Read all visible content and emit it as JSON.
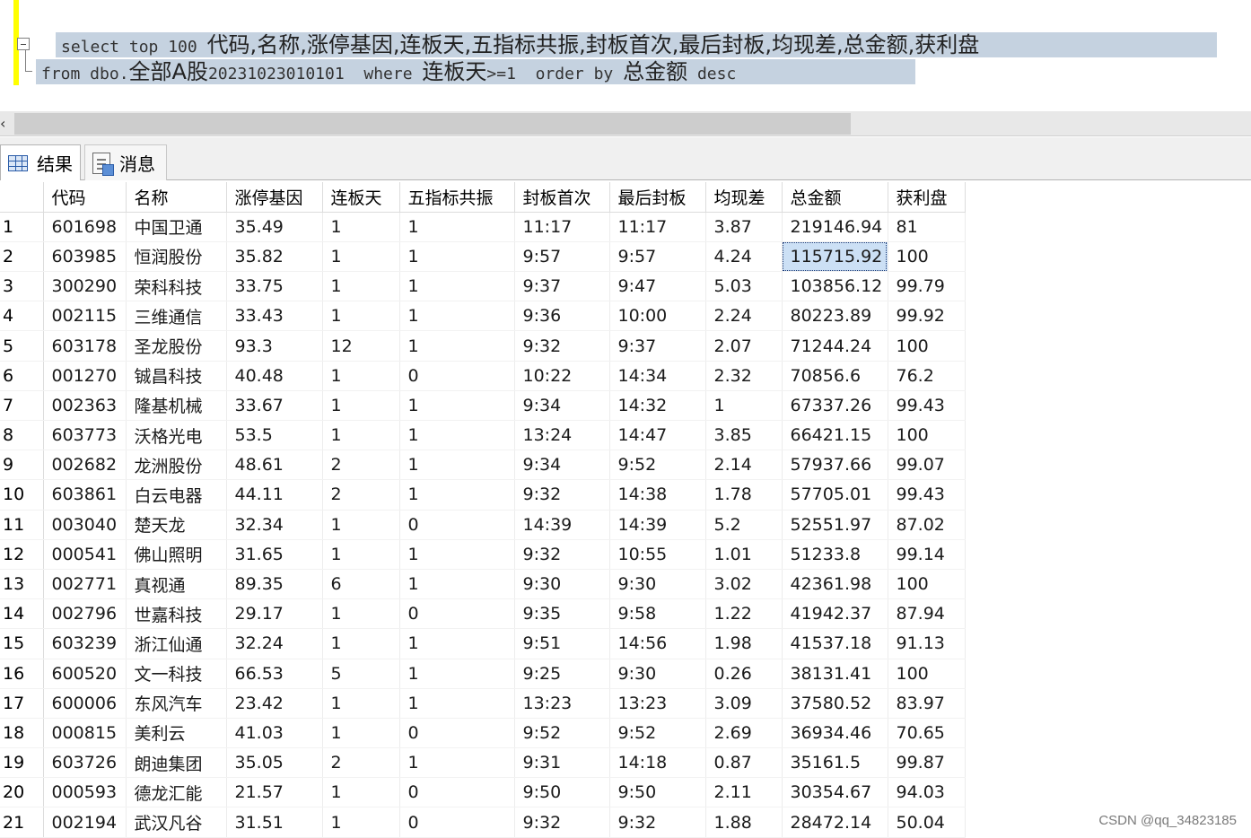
{
  "editor": {
    "line1_kw": "select top 100 ",
    "line1_cols": "代码,名称,涨停基因,连板天,五指标共振,封板首次,最后封板,均现差,总金额,获利盘",
    "line2_from": "from dbo.",
    "line2_table": "全部A股",
    "line2_table_suffix": "20231023010101  where ",
    "line2_col": "连板天",
    "line2_cond": ">=1  order by ",
    "line2_ordercol": "总金额",
    "line2_tail": " desc"
  },
  "scrollbar": {
    "arrow": "‹"
  },
  "tabs": {
    "results_label": "结果",
    "messages_label": "消息"
  },
  "grid": {
    "columns": [
      "",
      "代码",
      "名称",
      "涨停基因",
      "连板天",
      "五指标共振",
      "封板首次",
      "最后封板",
      "均现差",
      "总金额",
      "获利盘"
    ],
    "selected": {
      "row": 2,
      "col": 9
    },
    "rows": [
      [
        "1",
        "601698",
        "中国卫通",
        "35.49",
        "1",
        "1",
        "11:17",
        "11:17",
        "3.87",
        "219146.94",
        "81"
      ],
      [
        "2",
        "603985",
        "恒润股份",
        "35.82",
        "1",
        "1",
        "9:57",
        "9:57",
        "4.24",
        "115715.92",
        "100"
      ],
      [
        "3",
        "300290",
        "荣科科技",
        "33.75",
        "1",
        "1",
        "9:37",
        "9:47",
        "5.03",
        "103856.12",
        "99.79"
      ],
      [
        "4",
        "002115",
        "三维通信",
        "33.43",
        "1",
        "1",
        "9:36",
        "10:00",
        "2.24",
        "80223.89",
        "99.92"
      ],
      [
        "5",
        "603178",
        "圣龙股份",
        "93.3",
        "12",
        "1",
        "9:32",
        "9:37",
        "2.07",
        "71244.24",
        "100"
      ],
      [
        "6",
        "001270",
        "铖昌科技",
        "40.48",
        "1",
        "0",
        "10:22",
        "14:34",
        "2.32",
        "70856.6",
        "76.2"
      ],
      [
        "7",
        "002363",
        "隆基机械",
        "33.67",
        "1",
        "1",
        "9:34",
        "14:32",
        "1",
        "67337.26",
        "99.43"
      ],
      [
        "8",
        "603773",
        "沃格光电",
        "53.5",
        "1",
        "1",
        "13:24",
        "14:47",
        "3.85",
        "66421.15",
        "100"
      ],
      [
        "9",
        "002682",
        "龙洲股份",
        "48.61",
        "2",
        "1",
        "9:34",
        "9:52",
        "2.14",
        "57937.66",
        "99.07"
      ],
      [
        "10",
        "603861",
        "白云电器",
        "44.11",
        "2",
        "1",
        "9:32",
        "14:38",
        "1.78",
        "57705.01",
        "99.43"
      ],
      [
        "11",
        "003040",
        "楚天龙",
        "32.34",
        "1",
        "0",
        "14:39",
        "14:39",
        "5.2",
        "52551.97",
        "87.02"
      ],
      [
        "12",
        "000541",
        "佛山照明",
        "31.65",
        "1",
        "1",
        "9:32",
        "10:55",
        "1.01",
        "51233.8",
        "99.14"
      ],
      [
        "13",
        "002771",
        "真视通",
        "89.35",
        "6",
        "1",
        "9:30",
        "9:30",
        "3.02",
        "42361.98",
        "100"
      ],
      [
        "14",
        "002796",
        "世嘉科技",
        "29.17",
        "1",
        "0",
        "9:35",
        "9:58",
        "1.22",
        "41942.37",
        "87.94"
      ],
      [
        "15",
        "603239",
        "浙江仙通",
        "32.24",
        "1",
        "1",
        "9:51",
        "14:56",
        "1.98",
        "41537.18",
        "91.13"
      ],
      [
        "16",
        "600520",
        "文一科技",
        "66.53",
        "5",
        "1",
        "9:25",
        "9:30",
        "0.26",
        "38131.41",
        "100"
      ],
      [
        "17",
        "600006",
        "东风汽车",
        "23.42",
        "1",
        "1",
        "13:23",
        "13:23",
        "3.09",
        "37580.52",
        "83.97"
      ],
      [
        "18",
        "000815",
        "美利云",
        "41.03",
        "1",
        "0",
        "9:52",
        "9:52",
        "2.69",
        "36934.46",
        "70.65"
      ],
      [
        "19",
        "603726",
        "朗迪集团",
        "35.05",
        "2",
        "1",
        "9:31",
        "14:18",
        "0.87",
        "35161.5",
        "99.87"
      ],
      [
        "20",
        "000593",
        "德龙汇能",
        "21.57",
        "1",
        "0",
        "9:50",
        "9:50",
        "2.11",
        "30354.67",
        "94.03"
      ],
      [
        "21",
        "002194",
        "武汉凡谷",
        "31.51",
        "1",
        "0",
        "9:32",
        "9:32",
        "1.88",
        "28472.14",
        "50.04"
      ]
    ]
  },
  "watermark": "CSDN @qq_34823185"
}
